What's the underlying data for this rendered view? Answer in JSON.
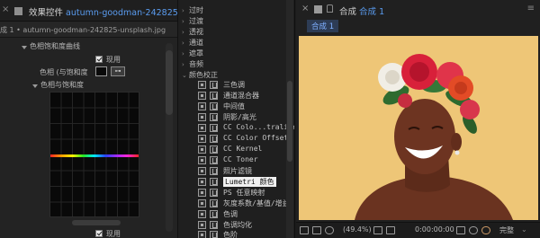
{
  "left_panel": {
    "tab_title_prefix": "效果控件",
    "tab_title_file": "autumn-goodman-242825-u",
    "sub_header": "成 1 • autumn-goodman-242825-unsplash.jpg",
    "effect_name": "色相饱和度曲线",
    "enable_label": "现用",
    "color_label": "色相 (与饱和度",
    "section_label": "色相与饱和度",
    "bottom_enable_label": "现用"
  },
  "middle_panel": {
    "categories": [
      {
        "label": "过时",
        "expanded": false
      },
      {
        "label": "过渡",
        "expanded": false
      },
      {
        "label": "透视",
        "expanded": false
      },
      {
        "label": "通道",
        "expanded": false
      },
      {
        "label": "遮罩",
        "expanded": false
      },
      {
        "label": "音频",
        "expanded": false
      },
      {
        "label": "颜色校正",
        "expanded": true
      }
    ],
    "effects": [
      {
        "label": "三色调",
        "selected": false
      },
      {
        "label": "通道混合器",
        "selected": false
      },
      {
        "label": "中间值",
        "selected": false
      },
      {
        "label": "阴影/高光",
        "selected": false
      },
      {
        "label": "CC Colo...tralizer",
        "selected": false
      },
      {
        "label": "CC Color Offset",
        "selected": false
      },
      {
        "label": "CC Kernel",
        "selected": false
      },
      {
        "label": "CC Toner",
        "selected": false
      },
      {
        "label": "照片滤镜",
        "selected": false
      },
      {
        "label": "Lumetri 颜色",
        "selected": true
      },
      {
        "label": "PS 任意映射",
        "selected": false
      },
      {
        "label": "灰度系数/基值/增益",
        "selected": false
      },
      {
        "label": "色调",
        "selected": false
      },
      {
        "label": "色调均化",
        "selected": false
      },
      {
        "label": "色阶",
        "selected": false
      }
    ]
  },
  "right_panel": {
    "tab_prefix": "合成",
    "tab_comp": "合成 1",
    "comp_tab_label": "合成 1",
    "zoom": "(49.4%)",
    "timecode": "0:00:00:00",
    "quality": "完整"
  }
}
